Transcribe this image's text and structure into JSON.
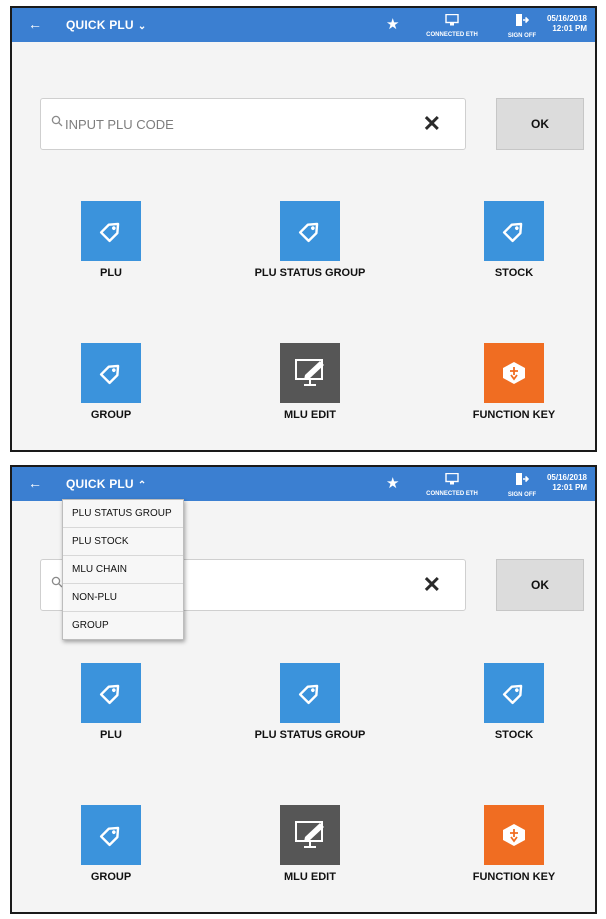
{
  "colors": {
    "topbar": "#3b7fd1",
    "tile_blue": "#3b93dc",
    "tile_dark": "#565656",
    "tile_orange": "#f06d22"
  },
  "screens": [
    {
      "topbar": {
        "back_icon": "arrow-left-icon",
        "title": "QUICK PLU",
        "chevron": "chevron-down-icon",
        "connected": "CONNECTED ETH",
        "signoff": "SIGN OFF",
        "date": "05/16/2018",
        "time": "12:01 PM"
      },
      "search": {
        "placeholder": "INPUT PLU CODE",
        "clear_icon": "close-icon"
      },
      "ok_label": "OK",
      "tiles": [
        {
          "label": "PLU",
          "icon": "price-tag-icon"
        },
        {
          "label": "PLU STATUS GROUP",
          "icon": "price-tag-icon"
        },
        {
          "label": "STOCK",
          "icon": "price-tag-icon"
        },
        {
          "label": "GROUP",
          "icon": "price-tag-icon"
        },
        {
          "label": "MLU EDIT",
          "icon": "monitor-edit-icon"
        },
        {
          "label": "FUNCTION KEY",
          "icon": "function-key-icon"
        }
      ]
    },
    {
      "topbar": {
        "back_icon": "arrow-left-icon",
        "title": "QUICK PLU",
        "chevron": "chevron-up-icon",
        "connected": "CONNECTED ETH",
        "signoff": "SIGN OFF",
        "date": "05/16/2018",
        "time": "12:01 PM"
      },
      "search": {
        "placeholder": "",
        "clear_icon": "close-icon"
      },
      "ok_label": "OK",
      "dropdown": [
        "PLU STATUS GROUP",
        "PLU STOCK",
        "MLU CHAIN",
        "NON-PLU",
        "GROUP"
      ],
      "tiles": [
        {
          "label": "PLU",
          "icon": "price-tag-icon"
        },
        {
          "label": "PLU STATUS GROUP",
          "icon": "price-tag-icon"
        },
        {
          "label": "STOCK",
          "icon": "price-tag-icon"
        },
        {
          "label": "GROUP",
          "icon": "price-tag-icon"
        },
        {
          "label": "MLU EDIT",
          "icon": "monitor-edit-icon"
        },
        {
          "label": "FUNCTION KEY",
          "icon": "function-key-icon"
        }
      ]
    }
  ]
}
